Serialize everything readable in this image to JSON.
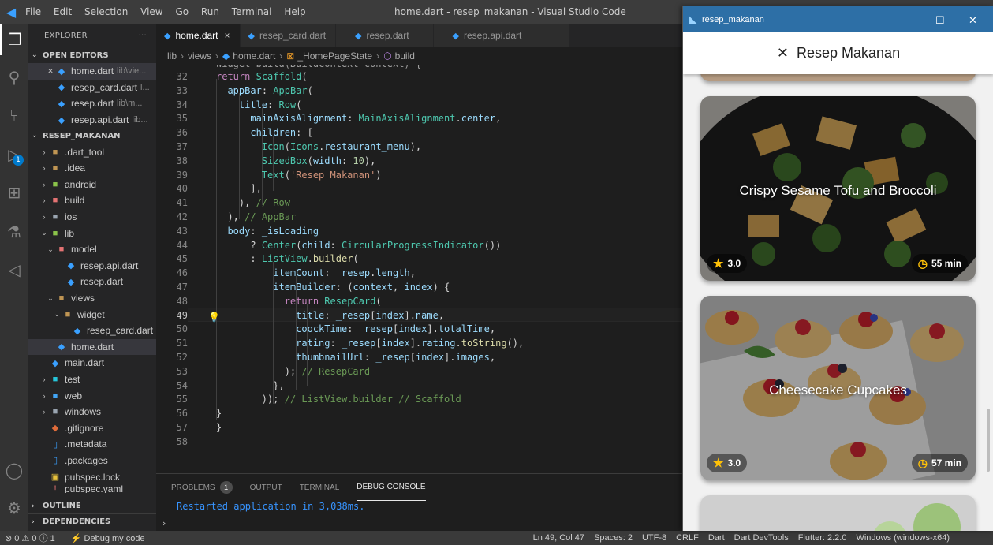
{
  "window": {
    "title": "home.dart - resep_makanan - Visual Studio Code",
    "menu": [
      "File",
      "Edit",
      "Selection",
      "View",
      "Go",
      "Run",
      "Terminal",
      "Help"
    ]
  },
  "activity": {
    "debug_badge": "1"
  },
  "sidebar": {
    "header": "EXPLORER",
    "more": "···",
    "open_editors_label": "OPEN EDITORS",
    "open_editors": [
      {
        "name": "home.dart",
        "path": "lib\\vie..."
      },
      {
        "name": "resep_card.dart",
        "path": "l..."
      },
      {
        "name": "resep.dart",
        "path": "lib\\m..."
      },
      {
        "name": "resep.api.dart",
        "path": "lib..."
      }
    ],
    "project_label": "RESEP_MAKANAN",
    "tree": [
      {
        "name": ".dart_tool"
      },
      {
        "name": ".idea"
      },
      {
        "name": "android"
      },
      {
        "name": "build"
      },
      {
        "name": "ios"
      },
      {
        "name": "lib"
      },
      {
        "name": "model"
      },
      {
        "name": "resep.api.dart"
      },
      {
        "name": "resep.dart"
      },
      {
        "name": "views"
      },
      {
        "name": "widget"
      },
      {
        "name": "resep_card.dart"
      },
      {
        "name": "home.dart"
      },
      {
        "name": "main.dart"
      },
      {
        "name": "test"
      },
      {
        "name": "web"
      },
      {
        "name": "windows"
      },
      {
        "name": ".gitignore"
      },
      {
        "name": ".metadata"
      },
      {
        "name": ".packages"
      },
      {
        "name": "pubspec.lock"
      },
      {
        "name": "pubspec.yaml"
      }
    ],
    "outline_label": "OUTLINE",
    "dependencies_label": "DEPENDENCIES"
  },
  "tabs": [
    {
      "label": "home.dart",
      "close": "×"
    },
    {
      "label": "resep_card.dart"
    },
    {
      "label": "resep.dart"
    },
    {
      "label": "resep.api.dart"
    }
  ],
  "breadcrumb": [
    "lib",
    "views",
    "home.dart",
    "_HomePageState",
    "build"
  ],
  "editor": {
    "line_numbers": [
      "32",
      "33",
      "34",
      "35",
      "36",
      "37",
      "38",
      "39",
      "40",
      "41",
      "42",
      "43",
      "44",
      "45",
      "46",
      "47",
      "48",
      "49",
      "50",
      "51",
      "52",
      "53",
      "54",
      "55",
      "56",
      "57",
      "58"
    ],
    "lines": [
      "return Scaffold(",
      "  appBar: AppBar(",
      "    title: Row(",
      "      mainAxisAlignment: MainAxisAlignment.center,",
      "      children: [",
      "        Icon(Icons.restaurant_menu),",
      "        SizedBox(width: 10),",
      "        Text('Resep Makanan')",
      "      ],",
      "    ), // Row",
      "  ), // AppBar",
      "  body: _isLoading",
      "      ? Center(child: CircularProgressIndicator())",
      "      : ListView.builder(",
      "          itemCount: _resep.length,",
      "          itemBuilder: (context, index) {",
      "            return ResepCard(",
      "              title: _resep[index].name,",
      "              coockTime: _resep[index].totalTime,",
      "              rating: _resep[index].rating.toString(),",
      "              thumbnailUrl: _resep[index].images,",
      "            ); // ResepCard",
      "          },",
      "        )); // ListView.builder // Scaffold",
      "}",
      "}",
      ""
    ]
  },
  "panel": {
    "tabs": [
      "PROBLEMS",
      "OUTPUT",
      "TERMINAL",
      "DEBUG CONSOLE"
    ],
    "problems_count": "1",
    "console_text": "Restarted application in 3,038ms."
  },
  "status": {
    "errors": "0",
    "warnings": "0",
    "info": "1",
    "debug": "Debug my code",
    "position": "Ln 49, Col 47",
    "spaces": "Spaces: 2",
    "encoding": "UTF-8",
    "eol": "CRLF",
    "lang": "Dart",
    "devtools": "Dart DevTools",
    "flutter": "Flutter: 2.2.0",
    "device": "Windows (windows-x64)"
  },
  "emulator": {
    "title": "resep_makanan",
    "controls": [
      "—",
      "☐",
      "✕"
    ],
    "app_title": "Resep Makanan",
    "cards": [
      {
        "title": "Crispy Sesame Tofu and Broccoli",
        "rating": "3.0",
        "time": "55 min"
      },
      {
        "title": "Cheesecake Cupcakes",
        "rating": "3.0",
        "time": "57 min"
      }
    ]
  },
  "colors": {
    "accent": "#007acc",
    "emu_titlebar": "#2d6fa6",
    "star": "#ffc107"
  }
}
